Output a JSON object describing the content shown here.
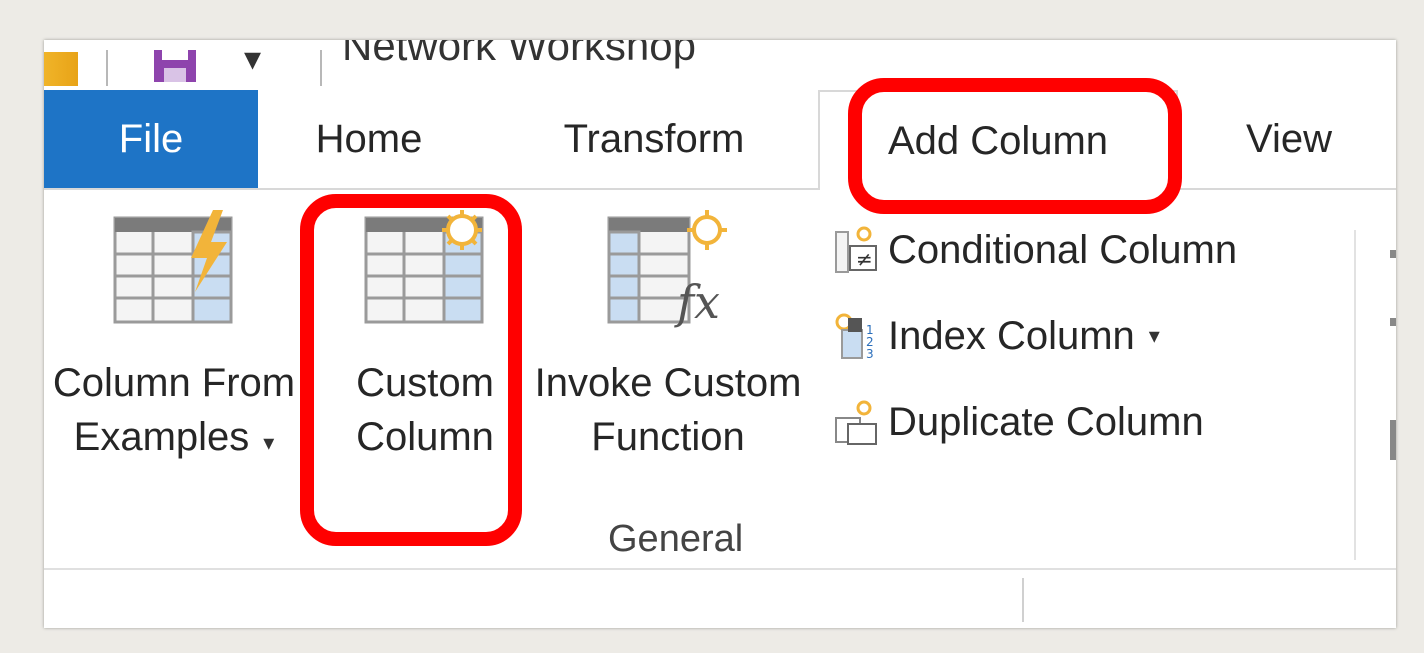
{
  "title_bar": {
    "title": "Network Workshop",
    "qat_dropdown_glyph": "▾",
    "icons": [
      "app-icon",
      "save-icon"
    ]
  },
  "tabs": [
    {
      "label": "File",
      "active": false
    },
    {
      "label": "Home",
      "active": false
    },
    {
      "label": "Transform",
      "active": false
    },
    {
      "label": "Add Column",
      "active": true
    },
    {
      "label": "View",
      "active": false
    }
  ],
  "ribbon": {
    "group_label": "General",
    "large_buttons": [
      {
        "line1": "Column From",
        "line2": "Examples",
        "has_dropdown": true,
        "icon": "column-from-examples-icon"
      },
      {
        "line1": "Custom",
        "line2": "Column",
        "has_dropdown": false,
        "icon": "custom-column-icon"
      },
      {
        "line1": "Invoke Custom",
        "line2": "Function",
        "has_dropdown": false,
        "icon": "invoke-custom-function-icon"
      }
    ],
    "small_buttons": [
      {
        "label": "Conditional Column",
        "icon": "conditional-column-icon",
        "has_dropdown": false
      },
      {
        "label": "Index Column",
        "icon": "index-column-icon",
        "has_dropdown": true
      },
      {
        "label": "Duplicate Column",
        "icon": "duplicate-column-icon",
        "has_dropdown": false
      }
    ],
    "dropdown_glyph": "▾"
  },
  "annotations": {
    "highlight_color": "#ff0000",
    "highlighted": [
      "Add Column",
      "Custom Column"
    ]
  },
  "colors": {
    "file_tab_bg": "#1e74c6",
    "file_tab_text": "#ffffff",
    "save_icon": "#8e44ad"
  }
}
